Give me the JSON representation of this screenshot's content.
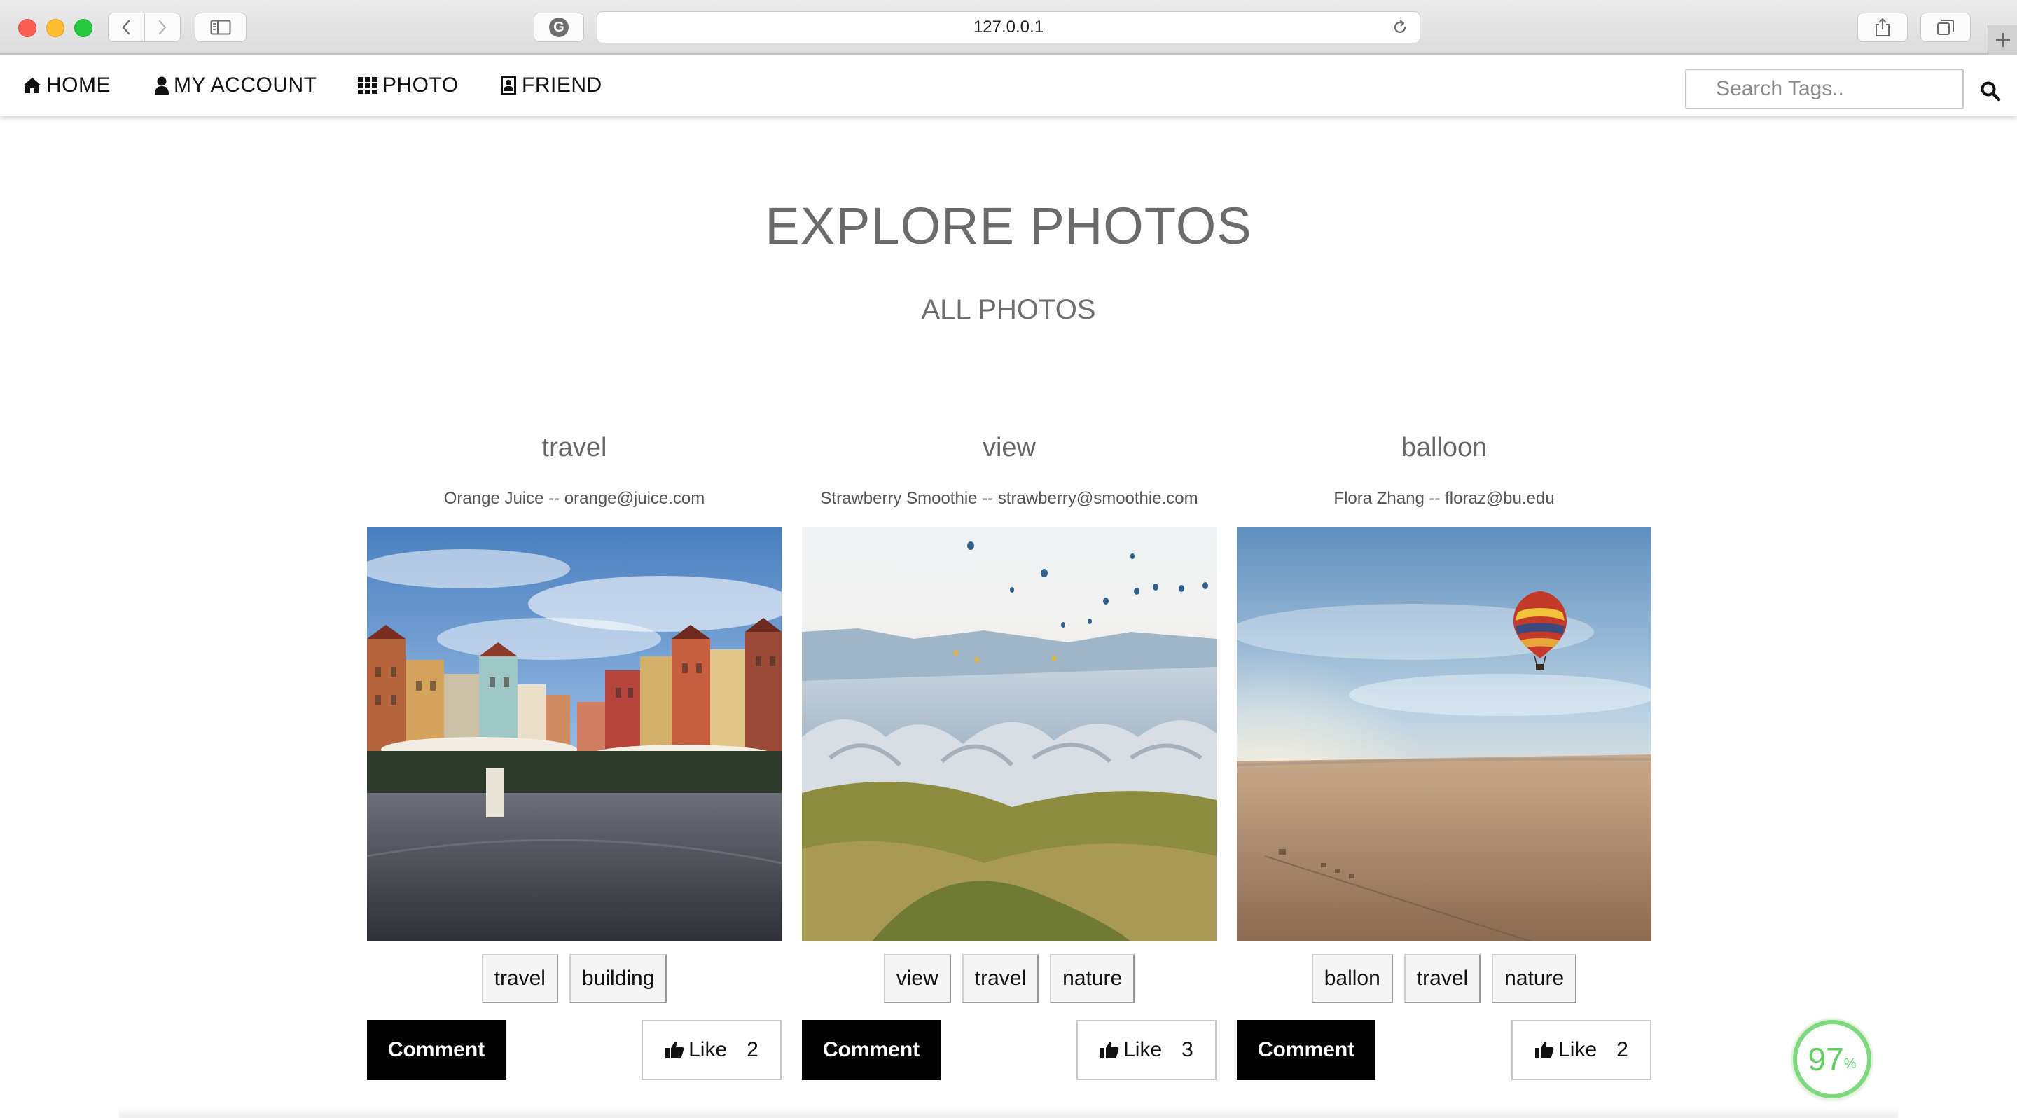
{
  "browser": {
    "url": "127.0.0.1",
    "google_badge": "G"
  },
  "nav": {
    "home": "HOME",
    "account": "MY ACCOUNT",
    "photo": "PHOTO",
    "friend": "FRIEND",
    "search_placeholder": "Search Tags.."
  },
  "page": {
    "title": "EXPLORE PHOTOS",
    "subtitle": "ALL PHOTOS"
  },
  "photos": [
    {
      "title": "travel",
      "owner": "Orange Juice -- orange@juice.com",
      "tags": [
        "travel",
        "building"
      ],
      "comment_label": "Comment",
      "like_label": "Like",
      "likes": "2"
    },
    {
      "title": "view",
      "owner": "Strawberry Smoothie -- strawberry@smoothie.com",
      "tags": [
        "view",
        "travel",
        "nature"
      ],
      "comment_label": "Comment",
      "like_label": "Like",
      "likes": "3"
    },
    {
      "title": "balloon",
      "owner": "Flora Zhang -- floraz@bu.edu",
      "tags": [
        "ballon",
        "travel",
        "nature"
      ],
      "comment_label": "Comment",
      "like_label": "Like",
      "likes": "2"
    }
  ],
  "badge": {
    "value": "97",
    "unit": "%"
  },
  "icons": {
    "home": "home-icon",
    "account": "user-icon",
    "photo": "grid-icon",
    "friend": "address-book-icon",
    "search": "search-icon",
    "like": "thumbs-up-icon"
  }
}
